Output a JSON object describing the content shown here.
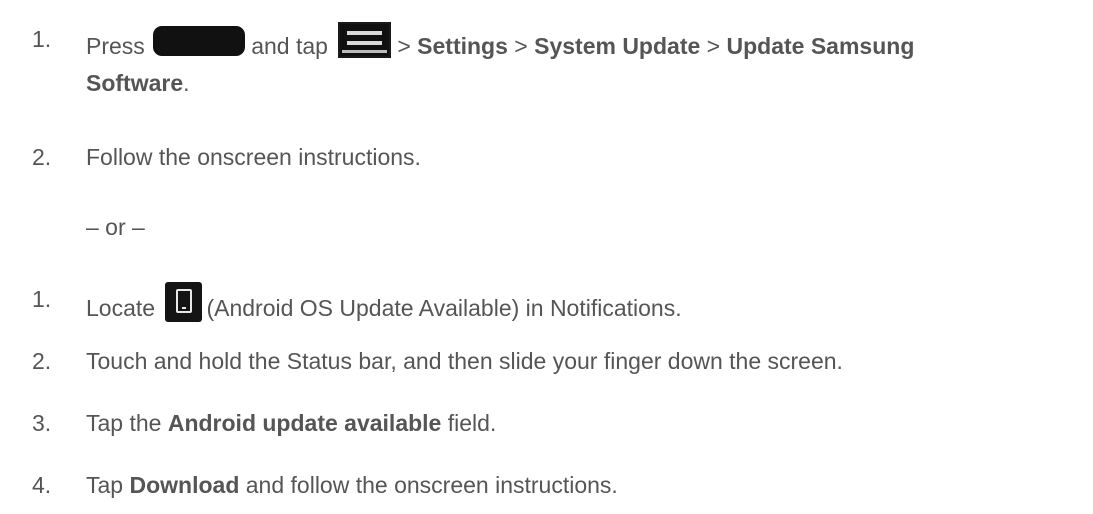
{
  "steps_a": [
    {
      "num": "1.",
      "press": "Press",
      "and_tap": "and tap",
      "sep1": ">",
      "settings": "Settings",
      "sep2": ">",
      "system_update": "System Update",
      "sep3": ">",
      "update_samsung": "Update Samsung",
      "software": "Software",
      "period": "."
    },
    {
      "num": "2.",
      "text": "Follow the onscreen instructions."
    }
  ],
  "or_separator": "– or –",
  "steps_b": [
    {
      "num": "1.",
      "locate": "Locate",
      "rest": "(Android OS Update Available) in Notifications."
    },
    {
      "num": "2.",
      "text": "Touch and hold the Status bar, and then slide your finger down the screen."
    },
    {
      "num": "3.",
      "tap": "Tap the",
      "field_name": "Android update available",
      "field_suffix": "field."
    },
    {
      "num": "4.",
      "tap": "Tap",
      "download": "Download",
      "rest": "and follow the onscreen instructions."
    }
  ],
  "icons": {
    "home_key": "home-key-icon",
    "menu_key": "menu-key-icon",
    "update_notification": "android-update-notification-icon"
  }
}
